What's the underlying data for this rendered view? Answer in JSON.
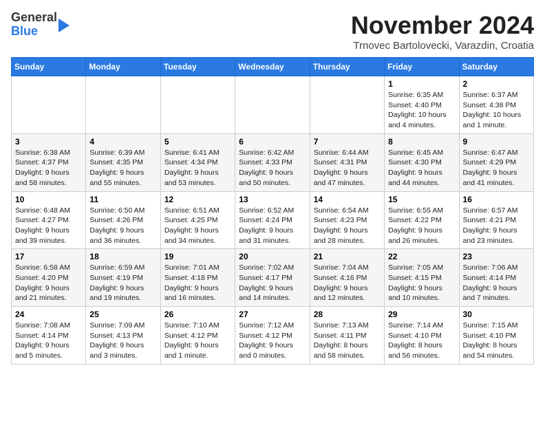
{
  "header": {
    "logo_line1": "General",
    "logo_line2": "Blue",
    "month_title": "November 2024",
    "location": "Trnovec Bartolovecki, Varazdin, Croatia"
  },
  "columns": [
    "Sunday",
    "Monday",
    "Tuesday",
    "Wednesday",
    "Thursday",
    "Friday",
    "Saturday"
  ],
  "weeks": [
    [
      {
        "day": "",
        "info": ""
      },
      {
        "day": "",
        "info": ""
      },
      {
        "day": "",
        "info": ""
      },
      {
        "day": "",
        "info": ""
      },
      {
        "day": "",
        "info": ""
      },
      {
        "day": "1",
        "info": "Sunrise: 6:35 AM\nSunset: 4:40 PM\nDaylight: 10 hours and 4 minutes."
      },
      {
        "day": "2",
        "info": "Sunrise: 6:37 AM\nSunset: 4:38 PM\nDaylight: 10 hours and 1 minute."
      }
    ],
    [
      {
        "day": "3",
        "info": "Sunrise: 6:38 AM\nSunset: 4:37 PM\nDaylight: 9 hours and 58 minutes."
      },
      {
        "day": "4",
        "info": "Sunrise: 6:39 AM\nSunset: 4:35 PM\nDaylight: 9 hours and 55 minutes."
      },
      {
        "day": "5",
        "info": "Sunrise: 6:41 AM\nSunset: 4:34 PM\nDaylight: 9 hours and 53 minutes."
      },
      {
        "day": "6",
        "info": "Sunrise: 6:42 AM\nSunset: 4:33 PM\nDaylight: 9 hours and 50 minutes."
      },
      {
        "day": "7",
        "info": "Sunrise: 6:44 AM\nSunset: 4:31 PM\nDaylight: 9 hours and 47 minutes."
      },
      {
        "day": "8",
        "info": "Sunrise: 6:45 AM\nSunset: 4:30 PM\nDaylight: 9 hours and 44 minutes."
      },
      {
        "day": "9",
        "info": "Sunrise: 6:47 AM\nSunset: 4:29 PM\nDaylight: 9 hours and 41 minutes."
      }
    ],
    [
      {
        "day": "10",
        "info": "Sunrise: 6:48 AM\nSunset: 4:27 PM\nDaylight: 9 hours and 39 minutes."
      },
      {
        "day": "11",
        "info": "Sunrise: 6:50 AM\nSunset: 4:26 PM\nDaylight: 9 hours and 36 minutes."
      },
      {
        "day": "12",
        "info": "Sunrise: 6:51 AM\nSunset: 4:25 PM\nDaylight: 9 hours and 34 minutes."
      },
      {
        "day": "13",
        "info": "Sunrise: 6:52 AM\nSunset: 4:24 PM\nDaylight: 9 hours and 31 minutes."
      },
      {
        "day": "14",
        "info": "Sunrise: 6:54 AM\nSunset: 4:23 PM\nDaylight: 9 hours and 28 minutes."
      },
      {
        "day": "15",
        "info": "Sunrise: 6:55 AM\nSunset: 4:22 PM\nDaylight: 9 hours and 26 minutes."
      },
      {
        "day": "16",
        "info": "Sunrise: 6:57 AM\nSunset: 4:21 PM\nDaylight: 9 hours and 23 minutes."
      }
    ],
    [
      {
        "day": "17",
        "info": "Sunrise: 6:58 AM\nSunset: 4:20 PM\nDaylight: 9 hours and 21 minutes."
      },
      {
        "day": "18",
        "info": "Sunrise: 6:59 AM\nSunset: 4:19 PM\nDaylight: 9 hours and 19 minutes."
      },
      {
        "day": "19",
        "info": "Sunrise: 7:01 AM\nSunset: 4:18 PM\nDaylight: 9 hours and 16 minutes."
      },
      {
        "day": "20",
        "info": "Sunrise: 7:02 AM\nSunset: 4:17 PM\nDaylight: 9 hours and 14 minutes."
      },
      {
        "day": "21",
        "info": "Sunrise: 7:04 AM\nSunset: 4:16 PM\nDaylight: 9 hours and 12 minutes."
      },
      {
        "day": "22",
        "info": "Sunrise: 7:05 AM\nSunset: 4:15 PM\nDaylight: 9 hours and 10 minutes."
      },
      {
        "day": "23",
        "info": "Sunrise: 7:06 AM\nSunset: 4:14 PM\nDaylight: 9 hours and 7 minutes."
      }
    ],
    [
      {
        "day": "24",
        "info": "Sunrise: 7:08 AM\nSunset: 4:14 PM\nDaylight: 9 hours and 5 minutes."
      },
      {
        "day": "25",
        "info": "Sunrise: 7:09 AM\nSunset: 4:13 PM\nDaylight: 9 hours and 3 minutes."
      },
      {
        "day": "26",
        "info": "Sunrise: 7:10 AM\nSunset: 4:12 PM\nDaylight: 9 hours and 1 minute."
      },
      {
        "day": "27",
        "info": "Sunrise: 7:12 AM\nSunset: 4:12 PM\nDaylight: 9 hours and 0 minutes."
      },
      {
        "day": "28",
        "info": "Sunrise: 7:13 AM\nSunset: 4:11 PM\nDaylight: 8 hours and 58 minutes."
      },
      {
        "day": "29",
        "info": "Sunrise: 7:14 AM\nSunset: 4:10 PM\nDaylight: 8 hours and 56 minutes."
      },
      {
        "day": "30",
        "info": "Sunrise: 7:15 AM\nSunset: 4:10 PM\nDaylight: 8 hours and 54 minutes."
      }
    ]
  ]
}
